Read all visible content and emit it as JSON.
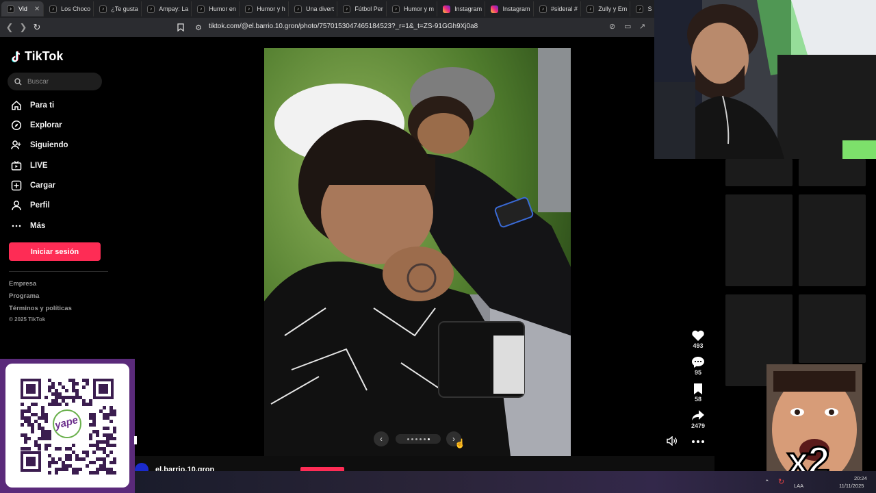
{
  "browser": {
    "tabs": [
      {
        "label": "Vid",
        "icon": "tiktok-icon",
        "active": true
      },
      {
        "label": "Los Choco",
        "icon": "tiktok-icon"
      },
      {
        "label": "¿Te gusta",
        "icon": "tiktok-icon"
      },
      {
        "label": "Ampay: La",
        "icon": "tiktok-icon"
      },
      {
        "label": "Humor en",
        "icon": "tiktok-icon"
      },
      {
        "label": "Humor y h",
        "icon": "tiktok-icon"
      },
      {
        "label": "Una divert",
        "icon": "tiktok-icon"
      },
      {
        "label": "Fútbol Per",
        "icon": "tiktok-icon"
      },
      {
        "label": "Humor y m",
        "icon": "tiktok-icon"
      },
      {
        "label": "Instagram",
        "icon": "instagram-icon"
      },
      {
        "label": "Instagram",
        "icon": "instagram-icon"
      },
      {
        "label": "#sideral #",
        "icon": "tiktok-icon"
      },
      {
        "label": "Zully y Em",
        "icon": "tiktok-icon"
      },
      {
        "label": "S",
        "icon": "tiktok-icon"
      }
    ],
    "url": "tiktok.com/@el.barrio.10.gron/photo/7570153047465184523?_r=1&_t=ZS-91GGh9Xj0a8"
  },
  "sidebar": {
    "brand": "TikTok",
    "search_placeholder": "Buscar",
    "items": [
      {
        "label": "Para ti",
        "icon": "home-icon"
      },
      {
        "label": "Explorar",
        "icon": "compass-icon"
      },
      {
        "label": "Siguiendo",
        "icon": "following-icon"
      },
      {
        "label": "LIVE",
        "icon": "live-icon"
      },
      {
        "label": "Cargar",
        "icon": "upload-icon"
      },
      {
        "label": "Perfil",
        "icon": "profile-icon"
      },
      {
        "label": "Más",
        "icon": "more-icon"
      }
    ],
    "login_label": "Iniciar sesión",
    "footer_links": [
      "Empresa",
      "Programa",
      "Términos y políticas"
    ],
    "copyright": "© 2025 TikTok"
  },
  "post": {
    "carousel_dots": 6,
    "active_dot": 5,
    "author": "el.barrio.10.gron"
  },
  "actions": [
    {
      "name": "like",
      "icon": "heart-icon",
      "count": "493"
    },
    {
      "name": "comment",
      "icon": "comment-icon",
      "count": "95"
    },
    {
      "name": "save",
      "icon": "bookmark-icon",
      "count": "58"
    },
    {
      "name": "share",
      "icon": "share-icon",
      "count": "2479"
    }
  ],
  "overlay": {
    "multiplier": "x2",
    "qr_brand": "yape"
  },
  "system": {
    "time": "20:24",
    "date": "11/11/2025",
    "lang": "LAA"
  },
  "colors": {
    "accent": "#fe2c55",
    "background": "#000000",
    "qr_frame": "#5a2a7a"
  }
}
